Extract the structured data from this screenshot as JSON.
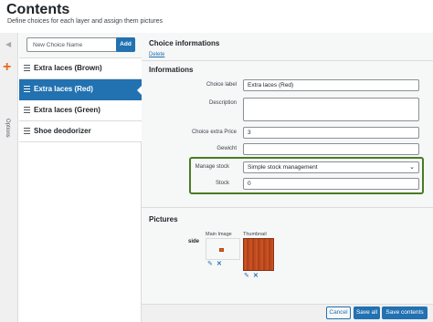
{
  "header": {
    "title": "Contents",
    "subtitle": "Define choices for each layer and assign them pictures"
  },
  "rail": {
    "collapse_icon": "left-triangle-icon",
    "add_icon": "plus-icon",
    "add_glyph": "+",
    "options_label": "Options"
  },
  "list": {
    "placeholder": "New Choice Name",
    "add_label": "Add",
    "items": [
      {
        "label": "Extra laces (Brown)",
        "active": false
      },
      {
        "label": "Extra laces (Red)",
        "active": true
      },
      {
        "label": "Extra laces (Green)",
        "active": false
      },
      {
        "label": "Shoe deodorizer",
        "active": false
      }
    ]
  },
  "main": {
    "choice_info_title": "Choice informations",
    "delete_label": "Delete",
    "informations_title": "Informations",
    "fields": {
      "choice_label": {
        "label": "Choice label",
        "value": "Extra laces (Red)"
      },
      "description": {
        "label": "Description",
        "value": ""
      },
      "extra_price": {
        "label": "Choice extra Price",
        "value": "3"
      },
      "weight": {
        "label": "Gewicht",
        "value": ""
      },
      "manage_stock": {
        "label": "Manage stock",
        "value": "Simple stock management"
      },
      "stock": {
        "label": "Stock",
        "value": "0"
      }
    },
    "pictures_title": "Pictures",
    "side_label": "side",
    "main_image_label": "Main Image",
    "thumbnail_label": "Thumbnail",
    "edit_icon": "pencil-icon",
    "remove_icon": "x-icon"
  },
  "footer": {
    "cancel_label": "Cancel",
    "save_all_label": "Save all",
    "save_contents_label": "Save contents"
  },
  "colors": {
    "accent": "#2271b1",
    "highlight": "#4a7b24",
    "add_icon": "#e86a1f"
  }
}
